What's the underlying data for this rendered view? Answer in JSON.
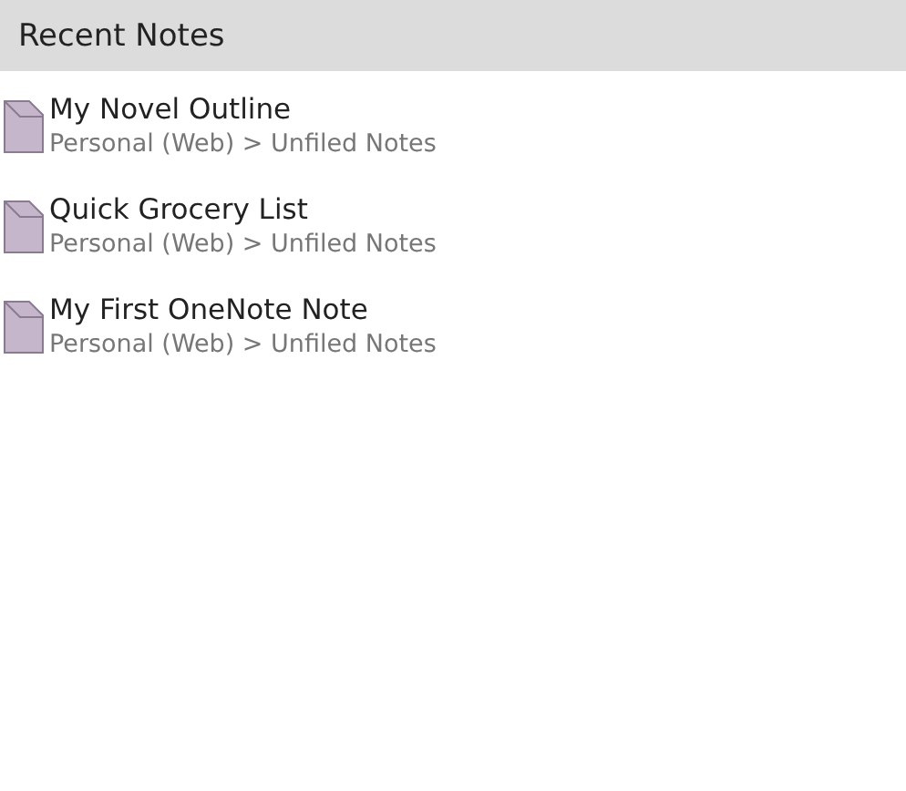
{
  "header": {
    "title": "Recent Notes"
  },
  "notes": [
    {
      "title": "My Novel Outline",
      "location": "Personal (Web) > Unfiled Notes"
    },
    {
      "title": "Quick Grocery List",
      "location": "Personal (Web) > Unfiled Notes"
    },
    {
      "title": "My First OneNote Note",
      "location": "Personal (Web) > Unfiled Notes"
    }
  ]
}
